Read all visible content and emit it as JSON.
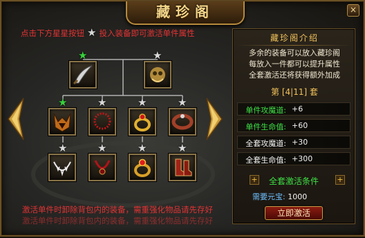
{
  "window": {
    "title": "藏珍阁",
    "close_label": "×"
  },
  "hints": {
    "top_left": "点击下方星星按钮",
    "top_right": "投入装备即可激活单件属性",
    "bottom_line1": "激活单件时卸除背包内的装备，需重强化物品请先存好",
    "bottom_line2": "激活单件时卸除背包内的装备，需重强化物品请先存好"
  },
  "tree": {
    "rows": [
      [
        {
          "item": "curved-blade",
          "star": "green"
        },
        {
          "item": "beast-armor",
          "star": "gray"
        }
      ],
      [
        {
          "item": "horned-helmet",
          "star": "green"
        },
        {
          "item": "red-bead-necklace",
          "star": "gray"
        },
        {
          "item": "gold-ruby-ring",
          "star": "gray"
        },
        {
          "item": "gem-bracer",
          "star": "gray"
        }
      ],
      [
        {
          "item": "fang-necklace",
          "star": "gray"
        },
        {
          "item": "crimson-necklace",
          "star": "gray"
        },
        {
          "item": "ruby-ring",
          "star": "gray"
        },
        {
          "item": "red-boots",
          "star": "gray"
        }
      ]
    ]
  },
  "panel": {
    "title": "藏珍阁介绍",
    "intro": [
      "多余的装备可以放入藏珍阁",
      "每放入一件都可以提升属性",
      "全套激活还将获得额外加成"
    ],
    "progress": "第 [4|11] 套",
    "attributes": [
      {
        "label": "单件攻魔道:",
        "value": "+6",
        "kind": "single"
      },
      {
        "label": "单件生命值:",
        "value": "+60",
        "kind": "single"
      },
      {
        "label": "全套攻魔道:",
        "value": "+30",
        "kind": "set"
      },
      {
        "label": "全套生命值:",
        "value": "+300",
        "kind": "set"
      }
    ],
    "condition_label": "全套激活条件",
    "cost_label": "需要元宝:",
    "cost_value": "1000",
    "activate_label": "立即激活"
  },
  "colors": {
    "hint_red": "#e03434",
    "attr_green": "#3ee046",
    "star_green": "#37d23c",
    "gold": "#f2c25a"
  }
}
